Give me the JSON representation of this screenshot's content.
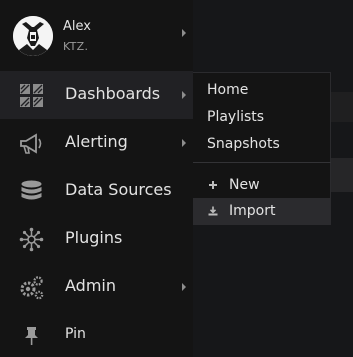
{
  "profile": {
    "name": "Alex",
    "org": "KTZ."
  },
  "nav": {
    "dashboards": "Dashboards",
    "alerting": "Alerting",
    "data_sources": "Data Sources",
    "plugins": "Plugins",
    "admin": "Admin",
    "pin": "Pin"
  },
  "dropdown": {
    "home": "Home",
    "playlists": "Playlists",
    "snapshots": "Snapshots",
    "new": "New",
    "import": "Import"
  }
}
